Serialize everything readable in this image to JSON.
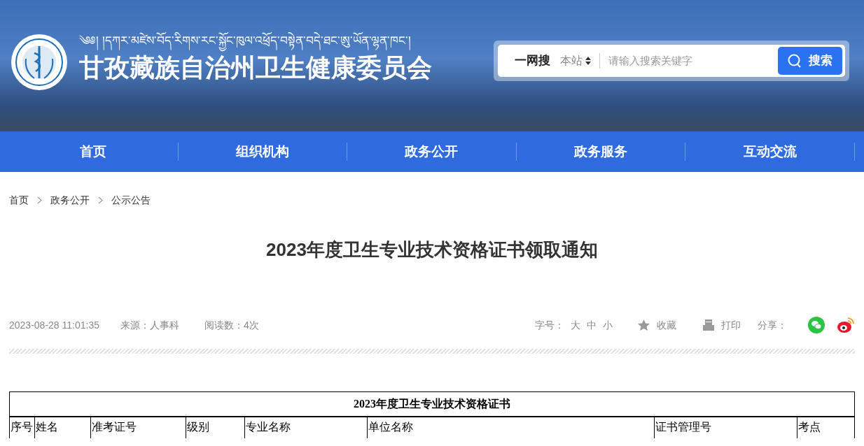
{
  "header": {
    "tibetan_name": "༄༅། །དཀར་མཛེས་བོད་རིགས་རང་སྐྱོང་ཁུལ་འཕྲོད་བསྟེན་བདེ་ཐང་ཨུ་ཡོན་ལྷན་ཁང་།",
    "site_name": "甘孜藏族自治州卫生健康委员会"
  },
  "search": {
    "label": "一网搜",
    "scope": "本站",
    "placeholder": "请输入搜索关键字",
    "button": "搜索"
  },
  "nav": [
    {
      "label": "首页"
    },
    {
      "label": "组织机构"
    },
    {
      "label": "政务公开"
    },
    {
      "label": "政务服务"
    },
    {
      "label": "互动交流"
    }
  ],
  "breadcrumb": [
    "首页",
    "政务公开",
    "公示公告"
  ],
  "article": {
    "title": "2023年度卫生专业技术资格证书领取通知",
    "date": "2023-08-28 11:01:35",
    "source": "来源：人事科",
    "views": "阅读数：4次"
  },
  "tools": {
    "font_size_label": "字号：",
    "sizes": [
      "大",
      "中",
      "小"
    ],
    "favorite": "收藏",
    "print": "打印",
    "share_label": "分享："
  },
  "table": {
    "caption": "2023年度卫生专业技术资格证书",
    "columns": [
      "序号",
      "姓名",
      "准考证号",
      "级别",
      "专业名称",
      "单位名称",
      "证书管理号",
      "考点"
    ]
  }
}
